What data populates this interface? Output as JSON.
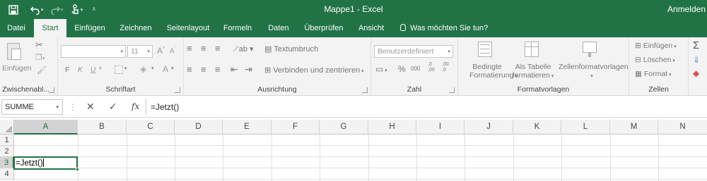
{
  "app": {
    "title": "Mappe1 - Excel",
    "sign_in": "Anmelden"
  },
  "quick_access": {
    "save_icon": "save-icon",
    "undo_icon": "undo-icon",
    "redo_icon": "redo-icon",
    "touch_icon": "touch-mode-icon",
    "customize_icon": "customize-icon"
  },
  "tabs": [
    "Datei",
    "Start",
    "Einfügen",
    "Zeichnen",
    "Seitenlayout",
    "Formeln",
    "Daten",
    "Überprüfen",
    "Ansicht"
  ],
  "active_tab": "Start",
  "tell_me": "Was möchten Sie tun?",
  "ribbon": {
    "clipboard": {
      "label": "Zwischenabl...",
      "paste": "Einfügen"
    },
    "font": {
      "label": "Schriftart",
      "font_name": "",
      "font_size": "11",
      "grow": "A",
      "shrink": "A",
      "bold": "F",
      "italic": "K",
      "underline": "U",
      "font_color": "A"
    },
    "alignment": {
      "label": "Ausrichtung",
      "wrap_text": "Textumbruch",
      "merge_center": "Verbinden und zentrieren"
    },
    "number": {
      "label": "Zahl",
      "format": "Benutzerdefiniert",
      "percent": "%",
      "thousands": "000",
      "inc_decimal": ",0\n,00",
      "dec_decimal": ",00\n,0"
    },
    "styles": {
      "label": "Formatvorlagen",
      "conditional_line1": "Bedingte",
      "conditional_line2": "Formatierung",
      "table_line1": "Als Tabelle",
      "table_line2": "formatieren",
      "cell_styles": "Zellenformatvorlagen"
    },
    "cells": {
      "label": "Zellen",
      "insert": "Einfügen",
      "delete": "Löschen",
      "format": "Format"
    },
    "editing": {
      "sum_icon": "autosum-icon"
    }
  },
  "formula_bar": {
    "name_box": "SUMME",
    "cancel": "✕",
    "enter": "✓",
    "fx": "fx",
    "content": "=Jetzt()"
  },
  "sheet": {
    "columns": [
      "A",
      "B",
      "C",
      "D",
      "E",
      "F",
      "G",
      "H",
      "I",
      "J",
      "K",
      "L",
      "M",
      "N"
    ],
    "rows": [
      "1",
      "2",
      "3",
      "4"
    ],
    "selected_column": "A",
    "selected_row": "3",
    "active_cell_value": "=Jetzt()"
  }
}
